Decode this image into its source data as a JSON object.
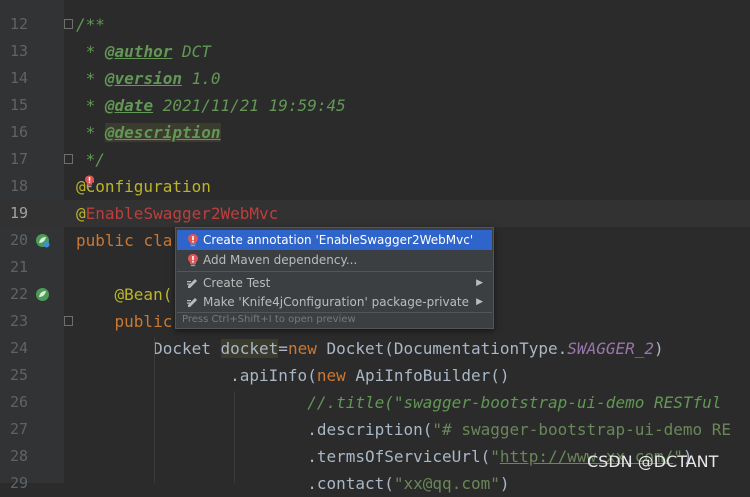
{
  "editor": {
    "lines": [
      {
        "number": "12",
        "segments": [
          {
            "cls": "t-cm",
            "text": "/**"
          }
        ]
      },
      {
        "number": "13",
        "segments": [
          {
            "cls": "t-cm",
            "text": " * "
          },
          {
            "cls": "t-tag",
            "text": "@author"
          },
          {
            "cls": "t-cm",
            "text": " DCT"
          }
        ]
      },
      {
        "number": "14",
        "segments": [
          {
            "cls": "t-cm",
            "text": " * "
          },
          {
            "cls": "t-tag",
            "text": "@version"
          },
          {
            "cls": "t-cm",
            "text": " 1.0"
          }
        ]
      },
      {
        "number": "15",
        "segments": [
          {
            "cls": "t-cm",
            "text": " * "
          },
          {
            "cls": "t-tag",
            "text": "@date"
          },
          {
            "cls": "t-cm",
            "text": " 2021/11/21 19:59:45"
          }
        ]
      },
      {
        "number": "16",
        "segments": [
          {
            "cls": "t-cm",
            "text": " * "
          },
          {
            "cls": "t-tag t-tagbg",
            "text": "@description"
          }
        ]
      },
      {
        "number": "17",
        "segments": [
          {
            "cls": "t-cm",
            "text": " */"
          }
        ]
      },
      {
        "number": "18",
        "segments": [
          {
            "cls": "t-ann",
            "text": "@Configuration"
          }
        ]
      },
      {
        "number": "19",
        "segments": [
          {
            "cls": "t-ann",
            "text": "@"
          },
          {
            "cls": "t-err",
            "text": "EnableSwagger2WebMvc"
          }
        ]
      },
      {
        "number": "20",
        "segments": [
          {
            "cls": "t-kw",
            "text": "public "
          },
          {
            "cls": "t-kw",
            "text": "cla"
          }
        ]
      },
      {
        "number": "21",
        "segments": []
      },
      {
        "number": "22",
        "segments": [
          {
            "cls": "",
            "text": "    "
          },
          {
            "cls": "t-ann",
            "text": "@Bean("
          }
        ]
      },
      {
        "number": "23",
        "segments": [
          {
            "cls": "",
            "text": "    "
          },
          {
            "cls": "t-kw",
            "text": "public"
          }
        ]
      },
      {
        "number": "24",
        "segments": [
          {
            "cls": "",
            "text": "        Docket "
          },
          {
            "cls": "t-var",
            "text": "docket"
          },
          {
            "cls": "",
            "text": "="
          },
          {
            "cls": "t-kw",
            "text": "new "
          },
          {
            "cls": "",
            "text": "Docket(DocumentationType."
          },
          {
            "cls": "t-st",
            "text": "SWAGGER_2"
          },
          {
            "cls": "",
            "text": ")"
          }
        ]
      },
      {
        "number": "25",
        "segments": [
          {
            "cls": "",
            "text": "                .apiInfo("
          },
          {
            "cls": "t-kw",
            "text": "new "
          },
          {
            "cls": "",
            "text": "ApiInfoBuilder()"
          }
        ]
      },
      {
        "number": "26",
        "segments": [
          {
            "cls": "",
            "text": "                        "
          },
          {
            "cls": "t-cm",
            "text": "//.title(\"swagger-bootstrap-ui-demo RESTful"
          }
        ]
      },
      {
        "number": "27",
        "segments": [
          {
            "cls": "",
            "text": "                        .description("
          },
          {
            "cls": "t-str",
            "text": "\"# swagger-bootstrap-ui-demo RE"
          }
        ]
      },
      {
        "number": "28",
        "segments": [
          {
            "cls": "",
            "text": "                        .termsOfServiceUrl("
          },
          {
            "cls": "t-str",
            "text": "\""
          },
          {
            "cls": "t-url",
            "text": "http://www.xx.com/"
          },
          {
            "cls": "t-str",
            "text": "\""
          },
          {
            "cls": "",
            "text": ")"
          }
        ]
      },
      {
        "number": "29",
        "segments": [
          {
            "cls": "",
            "text": "                        .contact("
          },
          {
            "cls": "t-str",
            "text": "\"xx@qq.com\""
          },
          {
            "cls": "",
            "text": ")"
          }
        ]
      }
    ]
  },
  "intention_popup": {
    "items": [
      {
        "label": "Create annotation 'EnableSwagger2WebMvc'",
        "icon": "error-bulb-icon",
        "selected": true,
        "submenu": false
      },
      {
        "label": "Add Maven dependency...",
        "icon": "error-bulb-icon",
        "selected": false,
        "submenu": false
      },
      {
        "label": "Create Test",
        "icon": "edit-intention-icon",
        "selected": false,
        "submenu": true
      },
      {
        "label": "Make 'Knife4jConfiguration' package-private",
        "icon": "edit-intention-icon",
        "selected": false,
        "submenu": true
      }
    ],
    "hint": "Press Ctrl+Shift+I to open preview"
  },
  "watermark": "CSDN @DCTANT",
  "colors": {
    "background": "#2b2b2b",
    "selection": "#2f65ca",
    "error": "#bc3f3c",
    "annotation": "#bbb529",
    "keyword": "#cc7832",
    "doc_comment": "#629755"
  }
}
